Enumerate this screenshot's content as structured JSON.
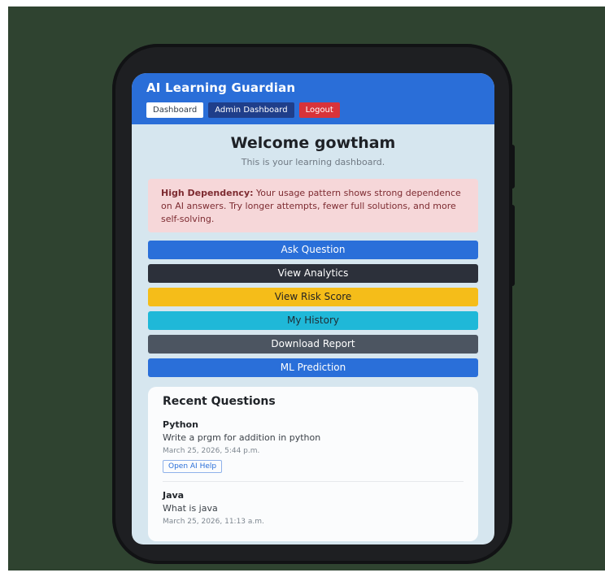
{
  "app": {
    "title": "AI Learning Guardian",
    "nav": {
      "dashboard": "Dashboard",
      "admin_dashboard": "Admin Dashboard",
      "logout": "Logout"
    }
  },
  "welcome": {
    "heading": "Welcome gowtham",
    "subtitle": "This is your learning dashboard."
  },
  "alert": {
    "title": "High Dependency:",
    "message": "Your usage pattern shows strong dependence on AI answers. Try longer attempts, fewer full solutions, and more self-solving."
  },
  "actions": {
    "ask_question": "Ask Question",
    "view_analytics": "View Analytics",
    "view_risk_score": "View Risk Score",
    "my_history": "My History",
    "download_report": "Download Report",
    "ml_prediction": "ML Prediction"
  },
  "recent_questions": {
    "title": "Recent Questions",
    "items": [
      {
        "topic": "Python",
        "question": "Write a prgm for addition in python",
        "date": "March 25, 2026, 5:44 p.m.",
        "button": "Open AI Help"
      },
      {
        "topic": "Java",
        "question": "What is java",
        "date": "March 25, 2026, 11:13 a.m."
      }
    ]
  },
  "colors": {
    "primary": "#2a6fd9",
    "dark": "#2c303a",
    "warning": "#f5bd19",
    "info": "#1fb8d8",
    "secondary": "#4c5561",
    "danger": "#d8333a",
    "alert_bg": "#f6d7d9",
    "backdrop": "#2f4330"
  }
}
